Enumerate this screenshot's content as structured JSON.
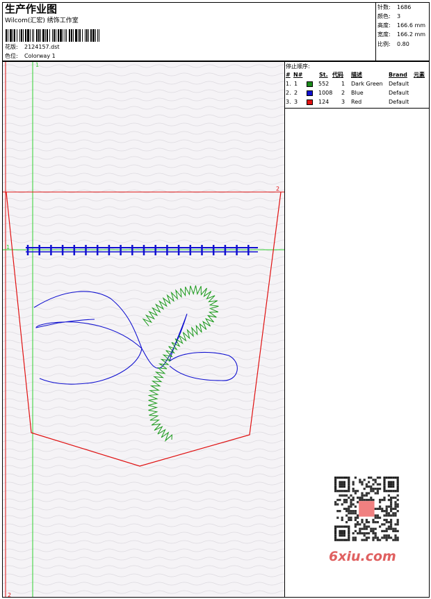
{
  "header": {
    "title": "生产作业图",
    "studio": "Wilcom(汇宏) 绣饰工作室",
    "design_label": "花版:",
    "design_value": "2124157.dst",
    "colorway_label": "色位:",
    "colorway_value": "Colorway 1"
  },
  "stats": [
    {
      "label": "针数:",
      "value": "1686"
    },
    {
      "label": "颜色:",
      "value": "3"
    },
    {
      "label": "高度:",
      "value": "166.6 mm"
    },
    {
      "label": "宽度:",
      "value": "166.2 mm"
    },
    {
      "label": "比例:",
      "value": "0.80"
    }
  ],
  "stop_sequence": {
    "title": "停止顺序:",
    "columns": [
      "#",
      "N#",
      "St.",
      "代码",
      "描述",
      "Brand",
      "元素"
    ],
    "rows": [
      {
        "num": "1.",
        "n": "1",
        "color": "#1a8a1a",
        "stitches": "552",
        "code": "1",
        "description": "Dark Green",
        "brand": "Default"
      },
      {
        "num": "2.",
        "n": "2",
        "color": "#1010d0",
        "stitches": "1008",
        "code": "2",
        "description": "Blue",
        "brand": "Default"
      },
      {
        "num": "3.",
        "n": "3",
        "color": "#e01010",
        "stitches": "124",
        "code": "3",
        "description": "Red",
        "brand": "Default"
      }
    ]
  },
  "guides": {
    "v1": "1",
    "v2": "2",
    "h1": "1",
    "h2": "2"
  },
  "watermark": {
    "text": "6xiu.com"
  },
  "colors": {
    "green_guide": "#30d030",
    "red_outline": "#e01010",
    "stitch_green": "#1a9a1a",
    "stitch_blue": "#1010d0"
  }
}
